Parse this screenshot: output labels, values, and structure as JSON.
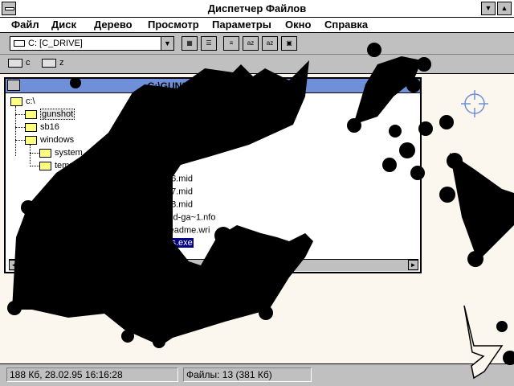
{
  "window": {
    "title": "Диспетчер Файлов"
  },
  "menu": [
    "Файл",
    "Диск",
    "Дерево",
    "Просмотр",
    "Параметры",
    "Окно",
    "Справка"
  ],
  "toolbar": {
    "drive_selected": "C: [C_DRIVE]"
  },
  "drives": [
    {
      "label": "c"
    },
    {
      "label": "z"
    }
  ],
  "child": {
    "title": "C:\\GUNSHOT\\*.* - [C_DRIVE]"
  },
  "tree": {
    "root": "c:\\",
    "items": [
      "gunshot",
      "sb16",
      "windows",
      "system",
      "temp"
    ]
  },
  "files": [
    "06.mid",
    "07.mid",
    "08.mid",
    "old-ga~1.nfo",
    "readme.wri",
    "ss.exe"
  ],
  "status": {
    "left": "188 Кб, 28.02.95 16:16:28",
    "right": "Файлы: 13 (381 Кб)"
  },
  "colors": {
    "titlebar_active": "#6f8fd8",
    "background": "#fbf6ee",
    "holes": "#000000"
  }
}
